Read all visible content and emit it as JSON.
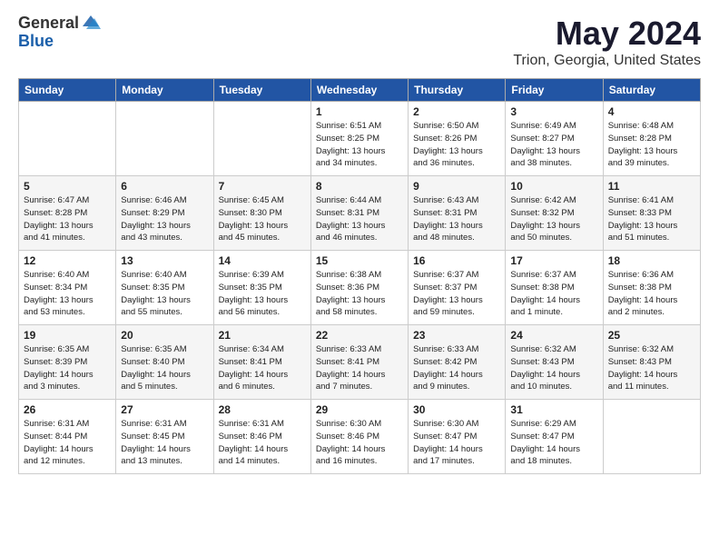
{
  "header": {
    "logo_general": "General",
    "logo_blue": "Blue",
    "title": "May 2024",
    "location": "Trion, Georgia, United States"
  },
  "weekdays": [
    "Sunday",
    "Monday",
    "Tuesday",
    "Wednesday",
    "Thursday",
    "Friday",
    "Saturday"
  ],
  "weeks": [
    [
      {
        "day": "",
        "info": ""
      },
      {
        "day": "",
        "info": ""
      },
      {
        "day": "",
        "info": ""
      },
      {
        "day": "1",
        "info": "Sunrise: 6:51 AM\nSunset: 8:25 PM\nDaylight: 13 hours\nand 34 minutes."
      },
      {
        "day": "2",
        "info": "Sunrise: 6:50 AM\nSunset: 8:26 PM\nDaylight: 13 hours\nand 36 minutes."
      },
      {
        "day": "3",
        "info": "Sunrise: 6:49 AM\nSunset: 8:27 PM\nDaylight: 13 hours\nand 38 minutes."
      },
      {
        "day": "4",
        "info": "Sunrise: 6:48 AM\nSunset: 8:28 PM\nDaylight: 13 hours\nand 39 minutes."
      }
    ],
    [
      {
        "day": "5",
        "info": "Sunrise: 6:47 AM\nSunset: 8:28 PM\nDaylight: 13 hours\nand 41 minutes."
      },
      {
        "day": "6",
        "info": "Sunrise: 6:46 AM\nSunset: 8:29 PM\nDaylight: 13 hours\nand 43 minutes."
      },
      {
        "day": "7",
        "info": "Sunrise: 6:45 AM\nSunset: 8:30 PM\nDaylight: 13 hours\nand 45 minutes."
      },
      {
        "day": "8",
        "info": "Sunrise: 6:44 AM\nSunset: 8:31 PM\nDaylight: 13 hours\nand 46 minutes."
      },
      {
        "day": "9",
        "info": "Sunrise: 6:43 AM\nSunset: 8:31 PM\nDaylight: 13 hours\nand 48 minutes."
      },
      {
        "day": "10",
        "info": "Sunrise: 6:42 AM\nSunset: 8:32 PM\nDaylight: 13 hours\nand 50 minutes."
      },
      {
        "day": "11",
        "info": "Sunrise: 6:41 AM\nSunset: 8:33 PM\nDaylight: 13 hours\nand 51 minutes."
      }
    ],
    [
      {
        "day": "12",
        "info": "Sunrise: 6:40 AM\nSunset: 8:34 PM\nDaylight: 13 hours\nand 53 minutes."
      },
      {
        "day": "13",
        "info": "Sunrise: 6:40 AM\nSunset: 8:35 PM\nDaylight: 13 hours\nand 55 minutes."
      },
      {
        "day": "14",
        "info": "Sunrise: 6:39 AM\nSunset: 8:35 PM\nDaylight: 13 hours\nand 56 minutes."
      },
      {
        "day": "15",
        "info": "Sunrise: 6:38 AM\nSunset: 8:36 PM\nDaylight: 13 hours\nand 58 minutes."
      },
      {
        "day": "16",
        "info": "Sunrise: 6:37 AM\nSunset: 8:37 PM\nDaylight: 13 hours\nand 59 minutes."
      },
      {
        "day": "17",
        "info": "Sunrise: 6:37 AM\nSunset: 8:38 PM\nDaylight: 14 hours\nand 1 minute."
      },
      {
        "day": "18",
        "info": "Sunrise: 6:36 AM\nSunset: 8:38 PM\nDaylight: 14 hours\nand 2 minutes."
      }
    ],
    [
      {
        "day": "19",
        "info": "Sunrise: 6:35 AM\nSunset: 8:39 PM\nDaylight: 14 hours\nand 3 minutes."
      },
      {
        "day": "20",
        "info": "Sunrise: 6:35 AM\nSunset: 8:40 PM\nDaylight: 14 hours\nand 5 minutes."
      },
      {
        "day": "21",
        "info": "Sunrise: 6:34 AM\nSunset: 8:41 PM\nDaylight: 14 hours\nand 6 minutes."
      },
      {
        "day": "22",
        "info": "Sunrise: 6:33 AM\nSunset: 8:41 PM\nDaylight: 14 hours\nand 7 minutes."
      },
      {
        "day": "23",
        "info": "Sunrise: 6:33 AM\nSunset: 8:42 PM\nDaylight: 14 hours\nand 9 minutes."
      },
      {
        "day": "24",
        "info": "Sunrise: 6:32 AM\nSunset: 8:43 PM\nDaylight: 14 hours\nand 10 minutes."
      },
      {
        "day": "25",
        "info": "Sunrise: 6:32 AM\nSunset: 8:43 PM\nDaylight: 14 hours\nand 11 minutes."
      }
    ],
    [
      {
        "day": "26",
        "info": "Sunrise: 6:31 AM\nSunset: 8:44 PM\nDaylight: 14 hours\nand 12 minutes."
      },
      {
        "day": "27",
        "info": "Sunrise: 6:31 AM\nSunset: 8:45 PM\nDaylight: 14 hours\nand 13 minutes."
      },
      {
        "day": "28",
        "info": "Sunrise: 6:31 AM\nSunset: 8:46 PM\nDaylight: 14 hours\nand 14 minutes."
      },
      {
        "day": "29",
        "info": "Sunrise: 6:30 AM\nSunset: 8:46 PM\nDaylight: 14 hours\nand 16 minutes."
      },
      {
        "day": "30",
        "info": "Sunrise: 6:30 AM\nSunset: 8:47 PM\nDaylight: 14 hours\nand 17 minutes."
      },
      {
        "day": "31",
        "info": "Sunrise: 6:29 AM\nSunset: 8:47 PM\nDaylight: 14 hours\nand 18 minutes."
      },
      {
        "day": "",
        "info": ""
      }
    ]
  ]
}
